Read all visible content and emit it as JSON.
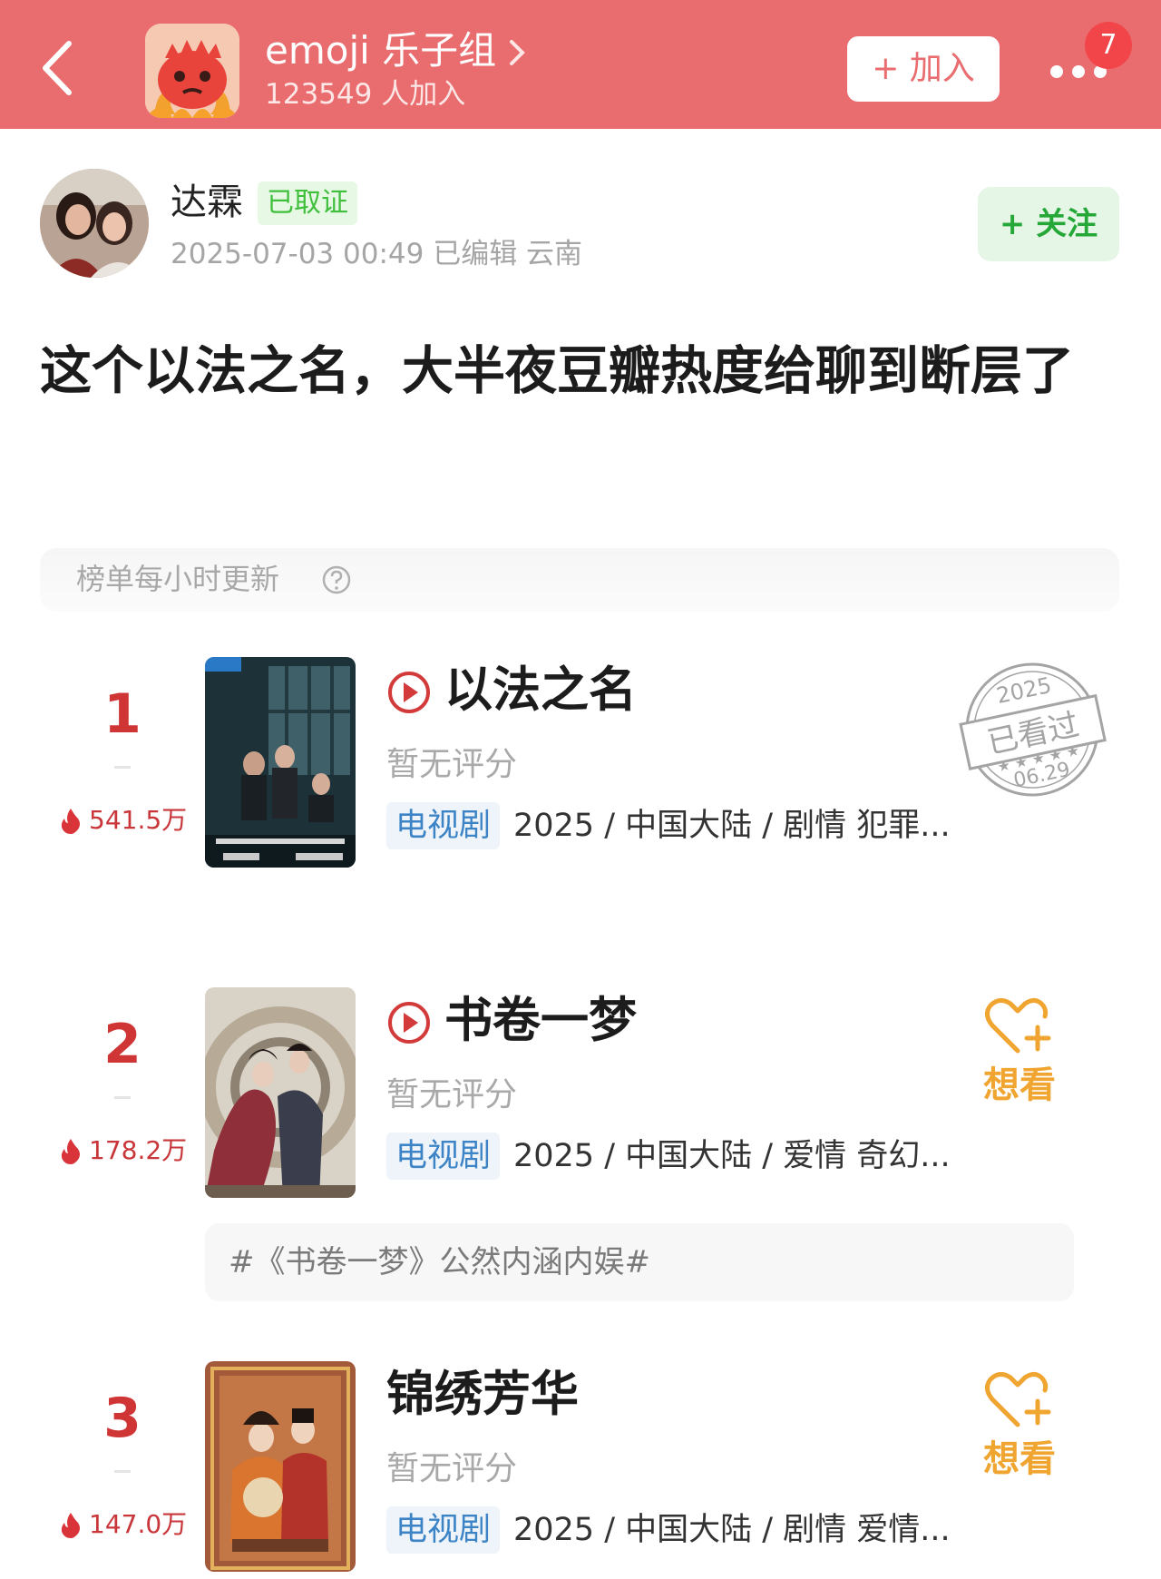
{
  "header": {
    "group_name": "emoji 乐子组",
    "members": "123549 人加入",
    "join_label": "+ 加入",
    "notification_count": "7",
    "bg_color": "#e96c6f"
  },
  "author": {
    "name": "达霖",
    "badge": "已取证",
    "meta": "2025-07-03 00:49  已编辑  云南",
    "follow_label": "+ 关注"
  },
  "post": {
    "title": "这个以法之名，大半夜豆瓣热度给聊到断层了"
  },
  "ranking": {
    "header": "榜单每小时更新",
    "items": [
      {
        "rank": "1",
        "heat": "541.5万",
        "title": "以法之名",
        "rating": "暂无评分",
        "type": "电视剧",
        "info": "2025 / 中国大陆 / 剧情 犯罪...",
        "stamp": {
          "year": "2025",
          "label": "已看过",
          "date": "06.29"
        }
      },
      {
        "rank": "2",
        "heat": "178.2万",
        "title": "书卷一梦",
        "rating": "暂无评分",
        "type": "电视剧",
        "info": "2025 / 中国大陆 / 爱情 奇幻...",
        "want": "想看",
        "topic": "#《书卷一梦》公然内涵内娱#"
      },
      {
        "rank": "3",
        "heat": "147.0万",
        "title": "锦绣芳华",
        "rating": "暂无评分",
        "type": "电视剧",
        "info": "2025 / 中国大陆 / 剧情 爱情...",
        "want": "想看"
      }
    ]
  },
  "colors": {
    "rank_red": "#d03535",
    "want_orange": "#f0a531",
    "tag_blue": "#3d84c6",
    "verify_green": "#3fbf3c"
  }
}
